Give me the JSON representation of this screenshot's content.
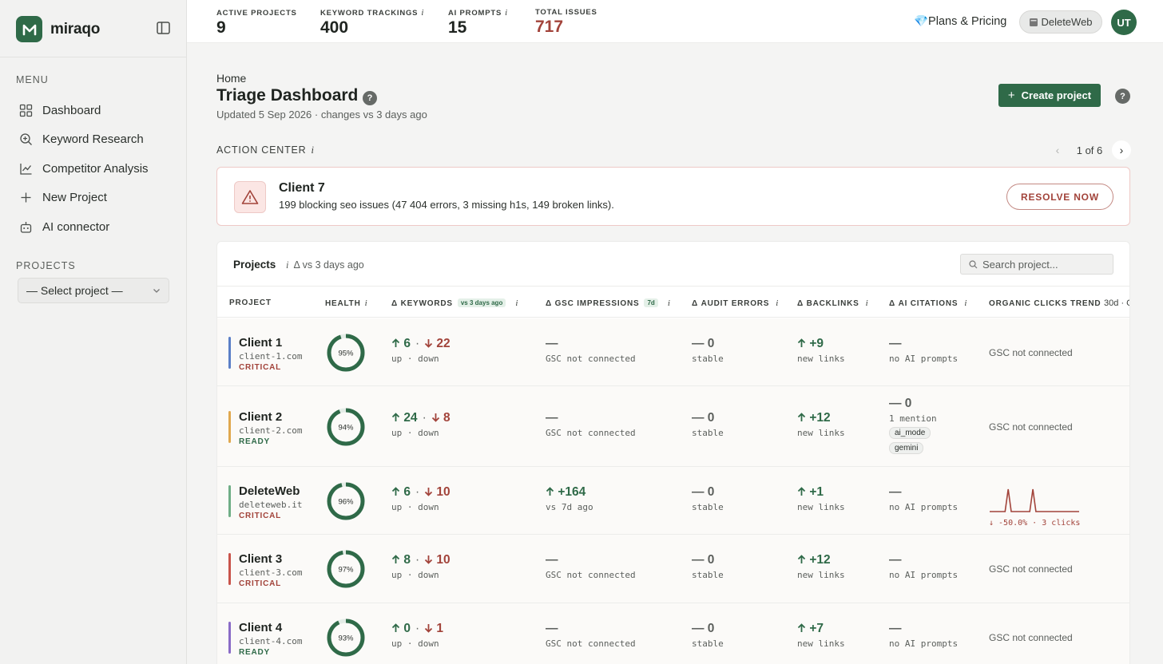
{
  "brand": {
    "name": "miraqo"
  },
  "sidebar": {
    "menu_label": "MENU",
    "items": [
      {
        "label": "Dashboard",
        "icon": "grid-icon"
      },
      {
        "label": "Keyword Research",
        "icon": "search-icon"
      },
      {
        "label": "Competitor Analysis",
        "icon": "chart-icon"
      },
      {
        "label": "New Project",
        "icon": "plus-icon"
      },
      {
        "label": "AI connector",
        "icon": "robot-icon"
      }
    ],
    "projects_label": "PROJECTS",
    "select_value": "— Select project —"
  },
  "topbar": {
    "stats": [
      {
        "label": "ACTIVE PROJECTS",
        "value": "9",
        "info": "",
        "color": "#1f2420"
      },
      {
        "label": "KEYWORD TRACKINGS",
        "value": "400",
        "info": "i",
        "color": "#1f2420"
      },
      {
        "label": "AI PROMPTS",
        "value": "15",
        "info": "i",
        "color": "#1f2420"
      },
      {
        "label": "TOTAL ISSUES",
        "value": "717",
        "info": "",
        "color": "#a2433a"
      }
    ],
    "plans_label": "💎Plans & Pricing",
    "site_label": "DeleteWeb",
    "avatar_initials": "UT"
  },
  "header": {
    "breadcrumb": "Home",
    "title": "Triage Dashboard",
    "help": "?",
    "updated": "Updated 5 Sep 2026 · changes vs 3 days ago",
    "create_label": "Create project",
    "create_icon": "+"
  },
  "action_center": {
    "label": "ACTION CENTER",
    "info": "i",
    "pager_prev": "‹",
    "pager_count": "1 of 6",
    "pager_next": "›",
    "alert_title": "Client 7",
    "alert_desc": "199 blocking seo issues (47 404 errors, 3 missing h1s, 149 broken links).",
    "resolve_label": "RESOLVE NOW"
  },
  "projects": {
    "title": "Projects",
    "info": "i",
    "subtitle": "Δ vs 3 days ago",
    "search_placeholder": "Search project...",
    "columns": [
      {
        "label": "PROJECT",
        "info": "",
        "tag": ""
      },
      {
        "label": "HEALTH",
        "info": "i",
        "tag": ""
      },
      {
        "label": "Δ KEYWORDS",
        "info": "i",
        "tag": "vs 3 days ago"
      },
      {
        "label": "Δ GSC IMPRESSIONS",
        "info": "i",
        "tag": "7d"
      },
      {
        "label": "Δ AUDIT ERRORS",
        "info": "i",
        "tag": ""
      },
      {
        "label": "Δ BACKLINKS",
        "info": "i",
        "tag": ""
      },
      {
        "label": "Δ AI CITATIONS",
        "info": "i",
        "tag": ""
      },
      {
        "label": "ORGANIC CLICKS TREND",
        "info": "",
        "tag": "",
        "suffix": "30d · G"
      }
    ],
    "rows": [
      {
        "name": "Client 1",
        "domain": "client-1.com",
        "status": "CRITICAL",
        "status_color": "#a2433a",
        "bar_color": "#5b7fc7",
        "health": 95,
        "health_label": "95%",
        "kw_up": "6",
        "kw_down": "22",
        "kw_sub": "up · down",
        "gsc_value": "—",
        "gsc_sub": "GSC not connected",
        "audit_value": "— 0",
        "audit_sub": "stable",
        "bl_value": "+9",
        "bl_sub": "new links",
        "ai_value": "—",
        "ai_sub": "no AI prompts",
        "ai_chips": [],
        "trend_text": "GSC not connected"
      },
      {
        "name": "Client 2",
        "domain": "client-2.com",
        "status": "READY",
        "status_color": "#2f6a48",
        "bar_color": "#e0a84f",
        "health": 94,
        "health_label": "94%",
        "kw_up": "24",
        "kw_down": "8",
        "kw_sub": "up · down",
        "gsc_value": "—",
        "gsc_sub": "GSC not connected",
        "audit_value": "— 0",
        "audit_sub": "stable",
        "bl_value": "+12",
        "bl_sub": "new links",
        "ai_value": "— 0",
        "ai_sub": "1 mention",
        "ai_chips": [
          "ai_mode",
          "gemini"
        ],
        "trend_text": "GSC not connected"
      },
      {
        "name": "DeleteWeb",
        "domain": "deleteweb.it",
        "status": "CRITICAL",
        "status_color": "#a2433a",
        "bar_color": "#6fae86",
        "health": 96,
        "health_label": "96%",
        "kw_up": "6",
        "kw_down": "10",
        "kw_sub": "up · down",
        "gsc_value": "+164",
        "gsc_sub": "vs 7d ago",
        "gsc_up": true,
        "audit_value": "— 0",
        "audit_sub": "stable",
        "bl_value": "+1",
        "bl_sub": "new links",
        "ai_value": "—",
        "ai_sub": "no AI prompts",
        "ai_chips": [],
        "trend_text": "",
        "trend_series": [
          0,
          0,
          0,
          0,
          0,
          0,
          1,
          0,
          0,
          0,
          0,
          0,
          0,
          0,
          1,
          0,
          0,
          0,
          0,
          0,
          0,
          0,
          0,
          0,
          0,
          0,
          0,
          0,
          0,
          0
        ],
        "trend_caption": "↓ -50.0% · 3 clicks"
      },
      {
        "name": "Client 3",
        "domain": "client-3.com",
        "status": "CRITICAL",
        "status_color": "#a2433a",
        "bar_color": "#c9544b",
        "health": 97,
        "health_label": "97%",
        "kw_up": "8",
        "kw_down": "10",
        "kw_sub": "up · down",
        "gsc_value": "—",
        "gsc_sub": "GSC not connected",
        "audit_value": "— 0",
        "audit_sub": "stable",
        "bl_value": "+12",
        "bl_sub": "new links",
        "ai_value": "—",
        "ai_sub": "no AI prompts",
        "ai_chips": [],
        "trend_text": "GSC not connected"
      },
      {
        "name": "Client 4",
        "domain": "client-4.com",
        "status": "READY",
        "status_color": "#2f6a48",
        "bar_color": "#8a6cc7",
        "health": 93,
        "health_label": "93%",
        "kw_up": "0",
        "kw_down": "1",
        "kw_sub": "up · down",
        "gsc_value": "—",
        "gsc_sub": "GSC not connected",
        "audit_value": "— 0",
        "audit_sub": "stable",
        "bl_value": "+7",
        "bl_sub": "new links",
        "ai_value": "—",
        "ai_sub": "no AI prompts",
        "ai_chips": [],
        "trend_text": "GSC not connected"
      }
    ]
  }
}
